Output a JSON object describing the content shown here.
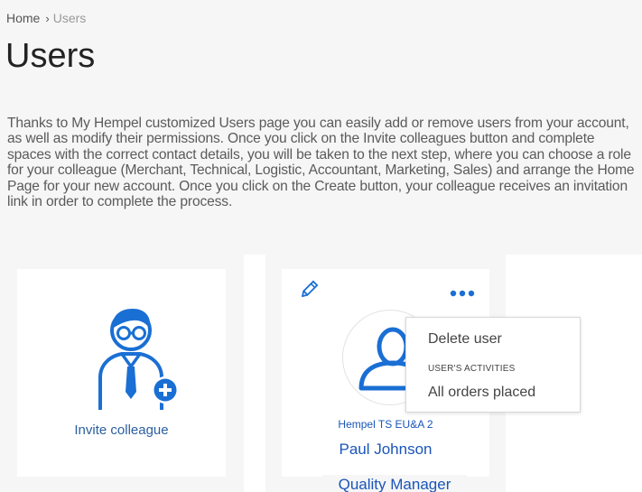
{
  "breadcrumb": {
    "home": "Home",
    "separator": "›",
    "current": "Users"
  },
  "page": {
    "title": "Users",
    "description": "Thanks to My Hempel customized Users page you can easily add or remove users from your account, as well as modify their permissions. Once you click on the Invite colleagues button and complete spaces with the correct contact details, you will be taken to the next step, where you can choose a role for your colleague (Merchant, Technical, Logistic, Accountant, Marketing, Sales) and arrange the Home Page for your new account. Once you click on the Create button, your colleague receives an invitation link in order to complete the process."
  },
  "invite_card": {
    "label": "Invite colleague",
    "icon": "user-add-icon"
  },
  "user_card": {
    "company": "Hempel TS EU&A 2",
    "name": "Paul Johnson",
    "role": "Quality Manager",
    "icons": [
      "pencil-icon",
      "more-dots-icon",
      "user-silhouette-icon"
    ]
  },
  "context_menu": {
    "delete_label": "Delete user",
    "activities_heading": "USER'S ACTIVITIES",
    "orders_label": "All orders placed"
  },
  "colors": {
    "accent_blue": "#1a6fd4",
    "link_blue": "#1a55b8",
    "panel_bg": "#f6f6f6"
  }
}
